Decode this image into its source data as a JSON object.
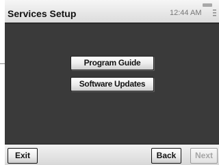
{
  "header": {
    "title": "Services Setup",
    "time": "12:44 AM",
    "status_icon": "menu-lines-icon"
  },
  "menu": {
    "items": [
      {
        "label": "Program Guide"
      },
      {
        "label": "Software Updates"
      }
    ]
  },
  "footer": {
    "exit_label": "Exit",
    "back_label": "Back",
    "next_label": "Next"
  },
  "colors": {
    "content_background": "#3a3a3a",
    "bar_background": "#e6e6e6",
    "disabled_text": "#a5a5a5"
  }
}
